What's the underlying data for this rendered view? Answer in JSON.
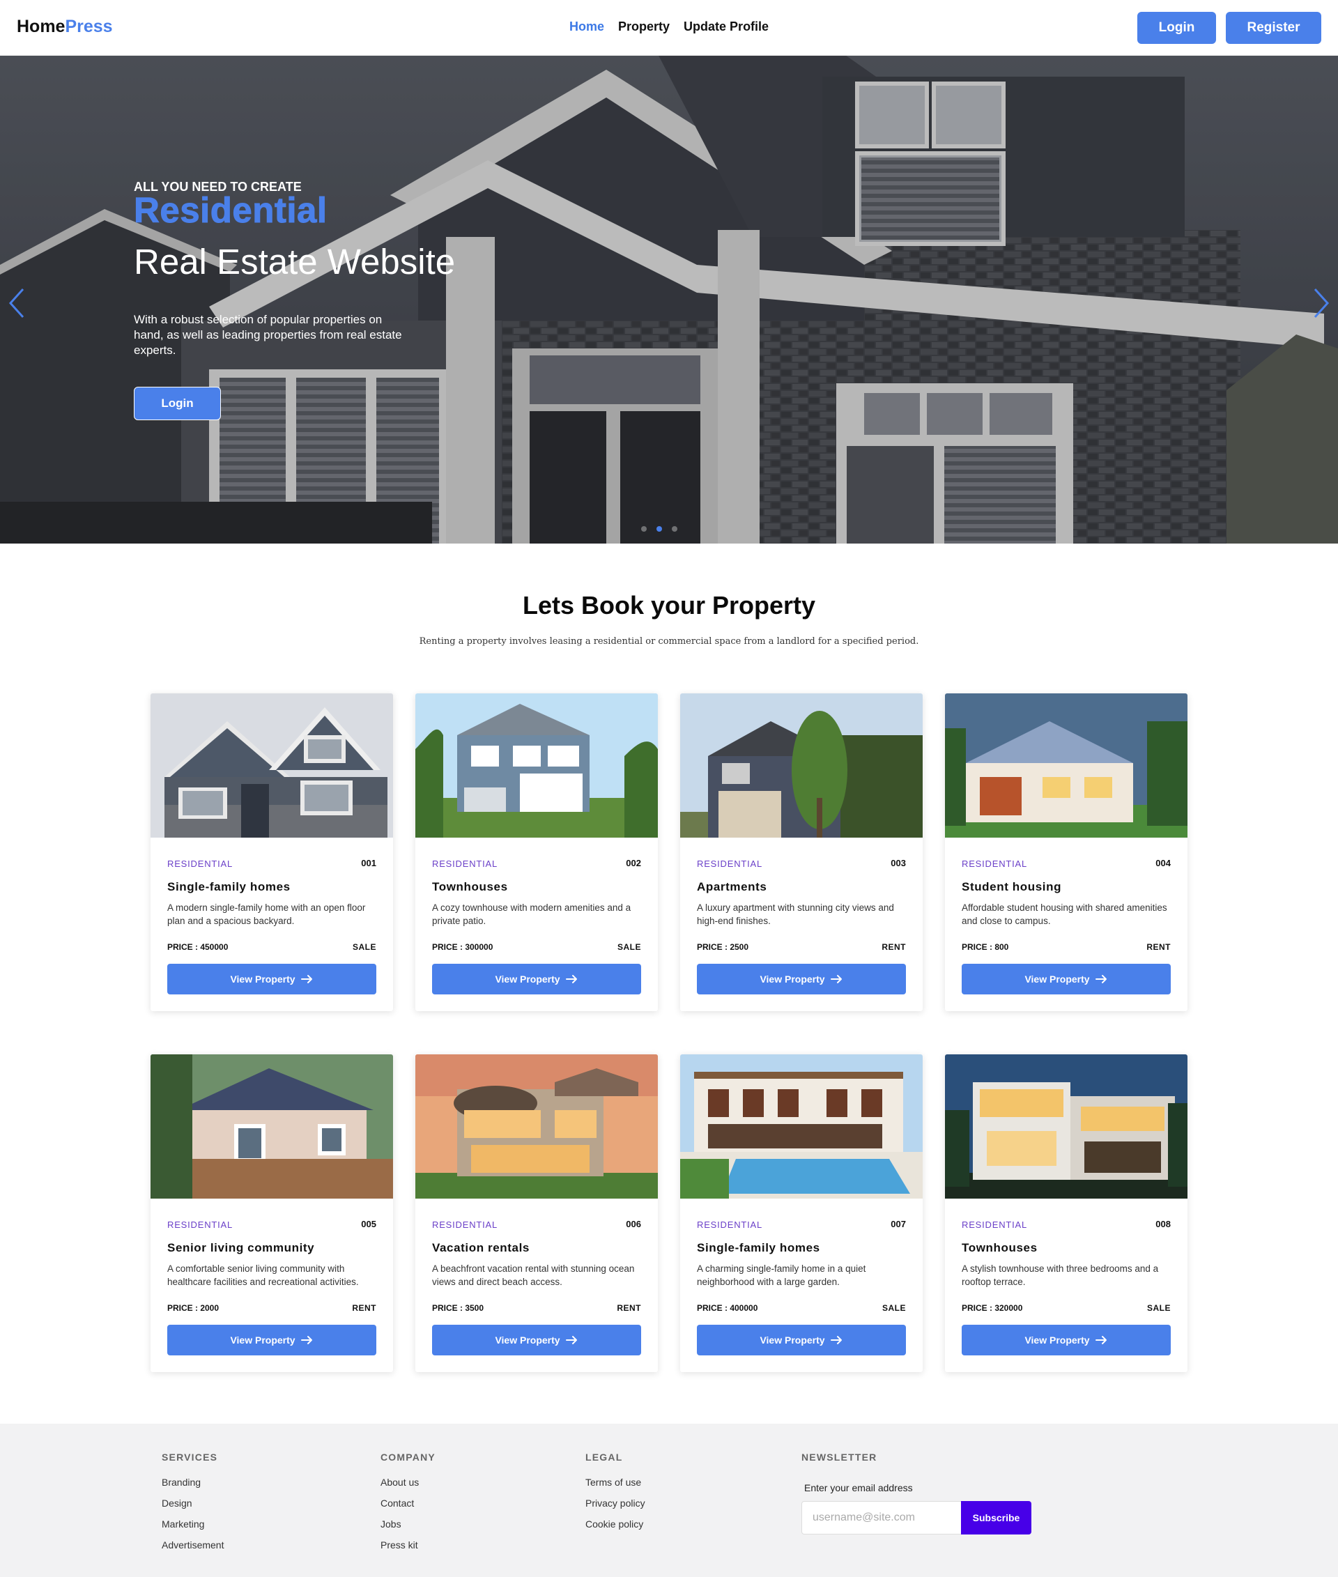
{
  "nav": {
    "logo_part1": "Home",
    "logo_part2": "Press",
    "links": [
      "Home",
      "Property",
      "Update Profile"
    ],
    "login_label": "Login",
    "register_label": "Register"
  },
  "hero": {
    "kicker": "ALL YOU NEED TO CREATE",
    "title": "Residential",
    "subtitle": "Real Estate Website",
    "description": "With a robust selection of popular properties on hand, as well as leading properties from real estate experts.",
    "button_label": "Login",
    "prev_icon": "chevron-left-icon",
    "next_icon": "chevron-right-icon",
    "slides_total": 3,
    "active_slide": 2
  },
  "section": {
    "title": "Lets Book your Property",
    "description": "Renting a property involves leasing a residential or commercial space from a landlord for a specified period."
  },
  "properties": [
    {
      "tag": "RESIDENTIAL",
      "id": "001",
      "title": "Single-family homes",
      "description": "A modern single-family home with an open floor plan and a spacious backyard.",
      "price": "PRICE : 450000",
      "mode": "SALE",
      "button": "View Property"
    },
    {
      "tag": "RESIDENTIAL",
      "id": "002",
      "title": "Townhouses",
      "description": "A cozy townhouse with modern amenities and a private patio.",
      "price": "PRICE : 300000",
      "mode": "SALE",
      "button": "View Property"
    },
    {
      "tag": "RESIDENTIAL",
      "id": "003",
      "title": "Apartments",
      "description": "A luxury apartment with stunning city views and high-end finishes.",
      "price": "PRICE : 2500",
      "mode": "RENT",
      "button": "View Property"
    },
    {
      "tag": "RESIDENTIAL",
      "id": "004",
      "title": "Student housing",
      "description": "Affordable student housing with shared amenities and close to campus.",
      "price": "PRICE : 800",
      "mode": "RENT",
      "button": "View Property"
    },
    {
      "tag": "RESIDENTIAL",
      "id": "005",
      "title": "Senior living community",
      "description": "A comfortable senior living community with healthcare facilities and recreational activities.",
      "price": "PRICE : 2000",
      "mode": "RENT",
      "button": "View Property"
    },
    {
      "tag": "RESIDENTIAL",
      "id": "006",
      "title": "Vacation rentals",
      "description": "A beachfront vacation rental with stunning ocean views and direct beach access.",
      "price": "PRICE : 3500",
      "mode": "RENT",
      "button": "View Property"
    },
    {
      "tag": "RESIDENTIAL",
      "id": "007",
      "title": "Single-family homes",
      "description": "A charming single-family home in a quiet neighborhood with a large garden.",
      "price": "PRICE : 400000",
      "mode": "SALE",
      "button": "View Property"
    },
    {
      "tag": "RESIDENTIAL",
      "id": "008",
      "title": "Townhouses",
      "description": "A stylish townhouse with three bedrooms and a rooftop terrace.",
      "price": "PRICE : 320000",
      "mode": "SALE",
      "button": "View Property"
    }
  ],
  "footer": {
    "services": {
      "heading": "SERVICES",
      "items": [
        "Branding",
        "Design",
        "Marketing",
        "Advertisement"
      ]
    },
    "company": {
      "heading": "COMPANY",
      "items": [
        "About us",
        "Contact",
        "Jobs",
        "Press kit"
      ]
    },
    "legal": {
      "heading": "LEGAL",
      "items": [
        "Terms of use",
        "Privacy policy",
        "Cookie policy"
      ]
    },
    "newsletter": {
      "heading": "NEWSLETTER",
      "label": "Enter your email address",
      "placeholder": "username@site.com",
      "button": "Subscribe"
    }
  },
  "colors": {
    "accent": "#4a80ea",
    "subscribe": "#4700e8",
    "tag": "#6a3fc8"
  }
}
